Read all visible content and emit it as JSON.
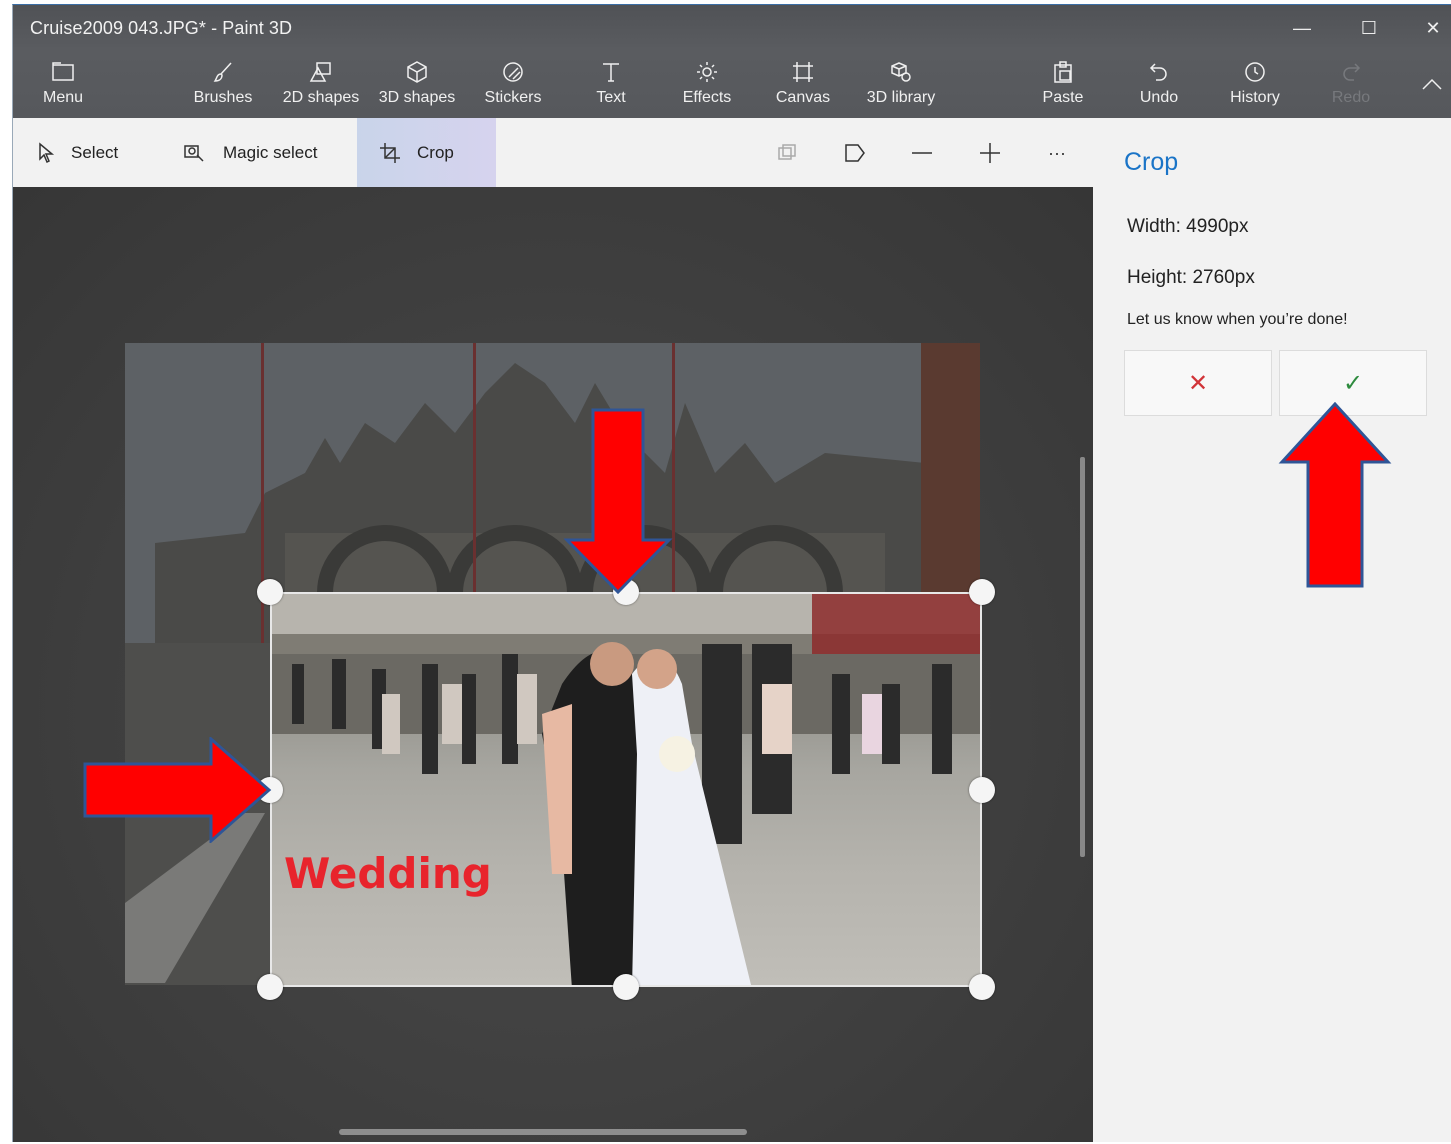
{
  "window": {
    "title": "Cruise2009 043.JPG* - Paint 3D",
    "controls": {
      "minimize": "—",
      "maximize": "☐",
      "close": "✕"
    }
  },
  "ribbon": {
    "menu": "Menu",
    "brushes": "Brushes",
    "shapes_2d": "2D shapes",
    "shapes_3d": "3D shapes",
    "stickers": "Stickers",
    "text": "Text",
    "effects": "Effects",
    "canvas": "Canvas",
    "library_3d": "3D library",
    "paste": "Paste",
    "undo": "Undo",
    "history": "History",
    "redo": "Redo"
  },
  "subtoolbar": {
    "select": "Select",
    "magic_select": "Magic select",
    "crop": "Crop",
    "more": "···"
  },
  "canvas": {
    "overlay_text": "Wedding"
  },
  "panel": {
    "title": "Crop",
    "width": "Width: 4990px",
    "height": "Height: 2760px",
    "hint": "Let us know when you’re done!",
    "cancel_symbol": "✕",
    "confirm_symbol": "✓"
  },
  "colors": {
    "accent": "#1a74c7",
    "annotation_arrow": "#ff0000",
    "arrow_outline": "#2f5597",
    "cancel": "#d13438",
    "confirm": "#2e8b3e"
  }
}
